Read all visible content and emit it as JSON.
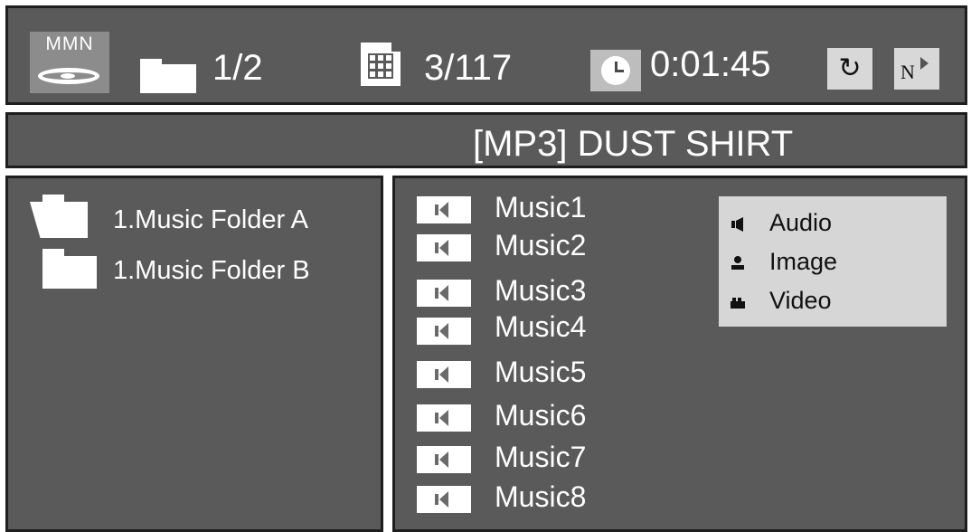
{
  "status": {
    "disc_label": "MMN",
    "folder_count": "1/2",
    "track_count": "3/117",
    "elapsed_time": "0:01:45",
    "icons": [
      "disc-icon",
      "folder-icon",
      "track-grid-icon",
      "clock-icon",
      "repeat-icon",
      "navigation-icon"
    ]
  },
  "title": "[MP3] DUST SHIRT",
  "folders": [
    {
      "label": "1.Music Folder A",
      "state": "open"
    },
    {
      "label": "1.Music Folder B",
      "state": "closed"
    }
  ],
  "files": [
    {
      "label": "Music1",
      "icon": "speaker-icon"
    },
    {
      "label": "Music2",
      "icon": "speaker-icon"
    },
    {
      "label": "Music3",
      "icon": "speaker-icon"
    },
    {
      "label": "Music4",
      "icon": "speaker-icon"
    },
    {
      "label": "Music5",
      "icon": "speaker-icon"
    },
    {
      "label": "Music6",
      "icon": "speaker-icon"
    },
    {
      "label": "Music7",
      "icon": "speaker-icon"
    },
    {
      "label": "Music8",
      "icon": "speaker-icon"
    }
  ],
  "legend": [
    {
      "label": "Audio",
      "icon": "speaker-icon"
    },
    {
      "label": "Image",
      "icon": "person-icon"
    },
    {
      "label": "Video",
      "icon": "camera-icon"
    }
  ],
  "colors": {
    "panel_background": "#5a5a5a",
    "panel_border": "#1e1e1e",
    "text": "#ffffff",
    "legend_background": "#d6d6d6"
  }
}
